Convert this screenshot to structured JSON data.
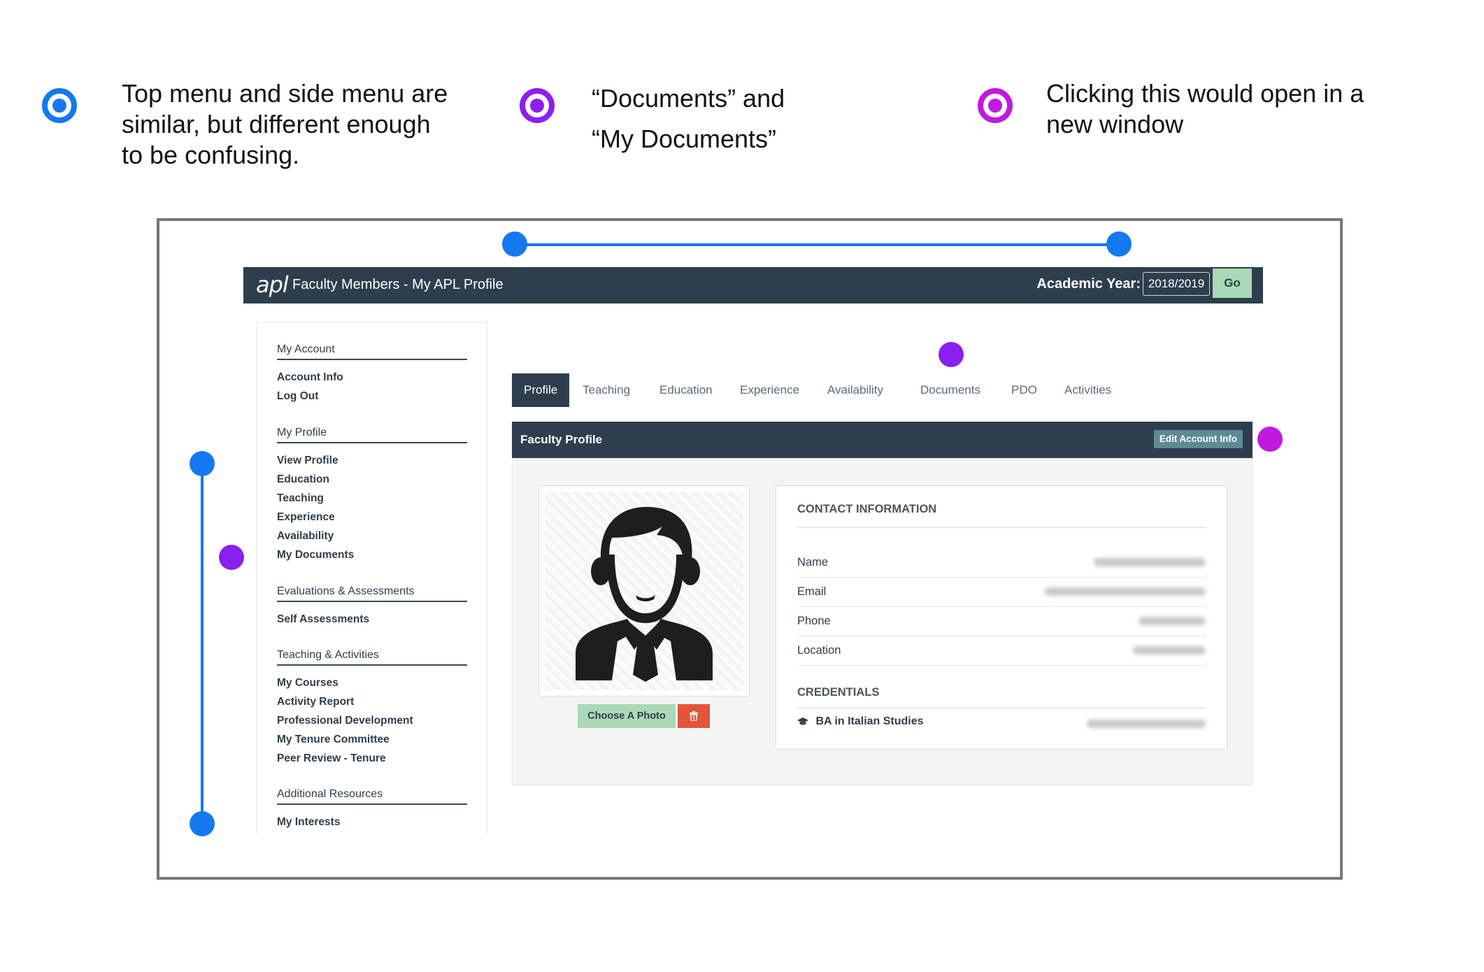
{
  "annotations": {
    "legend": [
      {
        "lines": [
          "Top menu and side menu are",
          "similar, but different enough",
          "to be confusing."
        ],
        "color": "#1479ef"
      },
      {
        "lines": [
          "“Documents” and",
          "“My Documents”"
        ],
        "color": "#8a1ff0"
      },
      {
        "lines": [
          "Clicking this would open in a",
          "new window"
        ],
        "color": "#c01ae0"
      }
    ]
  },
  "app": {
    "logo": "apl",
    "title": "Faculty Members - My APL Profile",
    "academic_year_label": "Academic Year:",
    "academic_year_value": "2018/2019",
    "go_label": "Go"
  },
  "sidebar": {
    "sections": [
      {
        "title": "My Account",
        "links": [
          "Account Info",
          "Log Out"
        ]
      },
      {
        "title": "My Profile",
        "links": [
          "View Profile",
          "Education",
          "Teaching",
          "Experience",
          "Availability",
          "My Documents"
        ]
      },
      {
        "title": "Evaluations & Assessments",
        "links": [
          "Self Assessments"
        ]
      },
      {
        "title": "Teaching & Activities",
        "links": [
          "My Courses",
          "Activity Report",
          "Professional Development",
          "My Tenure Committee",
          "Peer Review - Tenure"
        ]
      },
      {
        "title": "Additional Resources",
        "links": [
          "My Interests"
        ]
      }
    ]
  },
  "tabs": [
    "Profile",
    "Teaching",
    "Education",
    "Experience",
    "Availability",
    "Documents",
    "PDO",
    "Activities"
  ],
  "active_tab": "Profile",
  "profile": {
    "header_title": "Faculty Profile",
    "edit_button": "Edit Account Info",
    "choose_photo": "Choose A Photo",
    "contact_heading": "CONTACT INFORMATION",
    "contact_rows": [
      "Name",
      "Email",
      "Phone",
      "Location"
    ],
    "credentials_heading": "CREDENTIALS",
    "credential": "BA in Italian Studies"
  },
  "colors": {
    "navbar": "#2e3e4c",
    "annotation_blue": "#1479ef",
    "annotation_purple": "#8a1ff0",
    "annotation_magenta": "#c01ae0",
    "go_button": "#a9d9b6",
    "delete_button": "#e2553a"
  },
  "icons": {
    "trash": "trash-icon",
    "graduation": "graduation-cap-icon",
    "avatar": "user-avatar-icon"
  }
}
